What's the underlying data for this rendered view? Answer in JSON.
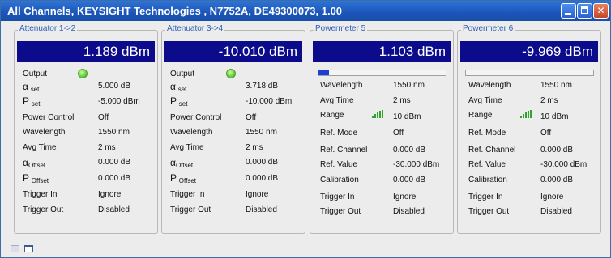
{
  "window": {
    "title": "All Channels,  KEYSIGHT Technologies , N7752A, DE49300073, 1.00"
  },
  "panels": [
    {
      "title": "Attenuator 1->2",
      "display": "1.189 dBm",
      "output_label": "Output",
      "rows": [
        {
          "label_main": "α",
          "label_sub": "set",
          "value": "5.000 dB"
        },
        {
          "label_main": "P",
          "label_sub": "set",
          "value": "-5.000 dBm"
        },
        {
          "label": "Power Control",
          "value": "Off"
        },
        {
          "label": "Wavelength",
          "value": "1550 nm"
        },
        {
          "label": "Avg Time",
          "value": "2 ms"
        },
        {
          "label_main": "α",
          "label_sub": "Offset",
          "value": "0.000 dB"
        },
        {
          "label_main": "P",
          "label_sub": "Offset",
          "value": "0.000 dB"
        },
        {
          "label": "Trigger In",
          "value": "Ignore"
        },
        {
          "label": "Trigger Out",
          "value": "Disabled"
        }
      ]
    },
    {
      "title": "Attenuator 3->4",
      "display": "-10.010 dBm",
      "output_label": "Output",
      "rows": [
        {
          "label_main": "α",
          "label_sub": "set",
          "value": "3.718 dB"
        },
        {
          "label_main": "P",
          "label_sub": "set",
          "value": "-10.000 dBm"
        },
        {
          "label": "Power Control",
          "value": "Off"
        },
        {
          "label": "Wavelength",
          "value": "1550 nm"
        },
        {
          "label": "Avg Time",
          "value": "2 ms"
        },
        {
          "label_main": "α",
          "label_sub": "Offset",
          "value": "0.000 dB"
        },
        {
          "label_main": "P",
          "label_sub": "Offset",
          "value": "0.000 dB"
        },
        {
          "label": "Trigger In",
          "value": "Ignore"
        },
        {
          "label": "Trigger Out",
          "value": "Disabled"
        }
      ]
    },
    {
      "title": "Powermeter 5",
      "display": "1.103 dBm",
      "power_level_fraction": 0.08,
      "rows": [
        {
          "label": "Wavelength",
          "value": "1550 nm"
        },
        {
          "label": "Avg Time",
          "value": "2 ms"
        },
        {
          "label": "Range",
          "value": "10 dBm",
          "icon": "signal-strength-icon"
        },
        {
          "label": "Ref. Mode",
          "value": "Off"
        },
        {
          "label": "Ref. Channel",
          "value": "0.000 dB"
        },
        {
          "label": "Ref. Value",
          "value": "-30.000 dBm"
        },
        {
          "label": "Calibration",
          "value": "0.000 dB"
        },
        {
          "label": "Trigger In",
          "value": "Ignore"
        },
        {
          "label": "Trigger Out",
          "value": "Disabled"
        }
      ]
    },
    {
      "title": "Powermeter 6",
      "display": "-9.969 dBm",
      "power_level_fraction": 0.0,
      "rows": [
        {
          "label": "Wavelength",
          "value": "1550 nm"
        },
        {
          "label": "Avg Time",
          "value": "2 ms"
        },
        {
          "label": "Range",
          "value": "10 dBm",
          "icon": "signal-strength-icon"
        },
        {
          "label": "Ref. Mode",
          "value": "Off"
        },
        {
          "label": "Ref. Channel",
          "value": "0.000 dB"
        },
        {
          "label": "Ref. Value",
          "value": "-30.000 dBm"
        },
        {
          "label": "Calibration",
          "value": "0.000 dB"
        },
        {
          "label": "Trigger In",
          "value": "Ignore"
        },
        {
          "label": "Trigger Out",
          "value": "Disabled"
        }
      ]
    }
  ],
  "colors": {
    "display_bg": "#0b0b8c",
    "title_blue": "#2f5fb5",
    "led_on": "#5fd23c",
    "power_bar": "#1a3ed6"
  },
  "statusbar": {
    "icons": [
      "tile-windows-icon",
      "window-icon"
    ]
  }
}
